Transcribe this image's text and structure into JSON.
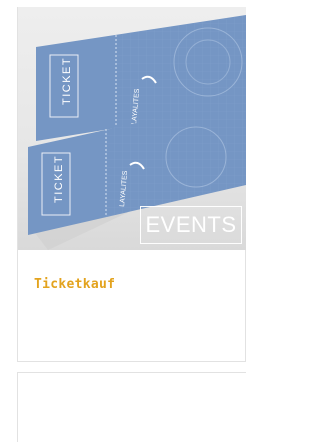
{
  "card": {
    "image_alt_icon": "event-tickets-photo",
    "ticket_text": "TICKET",
    "ticket_brand": "LAYALITES",
    "badge_label": "EVENTS",
    "title": "Ticketkauf"
  },
  "colors": {
    "ticket_blue": "#7596c4",
    "title_accent": "#e3a31e"
  }
}
